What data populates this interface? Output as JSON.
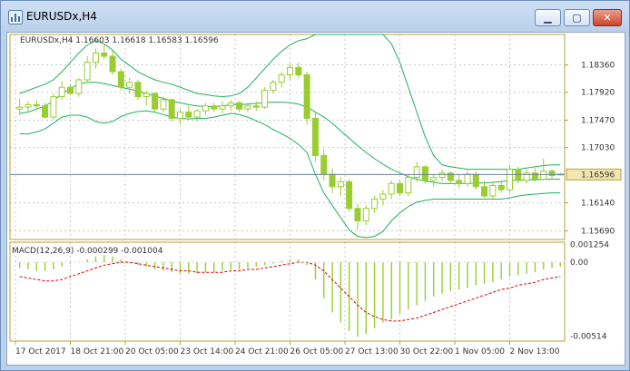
{
  "window": {
    "title": "EURUSDx,H4",
    "icon": "chart-window-icon",
    "buttons": {
      "minimize": "minimize-icon",
      "maximize": "maximize-icon",
      "close": "close-icon"
    }
  },
  "main_legend": "EURUSDx,H4  1.16603 1.16618 1.16583 1.16596",
  "macd_legend": "MACD(12,26,9) -0.000299 -0.001004",
  "price_axis": [
    "1.18360",
    "1.17920",
    "1.17470",
    "1.17030",
    "1.16140",
    "1.15690"
  ],
  "current_price": "1.16596",
  "macd_axis": [
    "0.001254",
    "0.00",
    "-0.00514"
  ],
  "time_axis": [
    "17 Oct 2017",
    "18 Oct 21:00",
    "20 Oct 05:00",
    "23 Oct 14:00",
    "24 Oct 21:00",
    "26 Oct 05:00",
    "27 Oct 13:00",
    "30 Oct 22:00",
    "1 Nov 05:00",
    "2 Nov 13:00"
  ],
  "colors": {
    "candle": "#9acd32",
    "bollinger": "#20b060",
    "grid": "#c8c8c8",
    "price_line": "#6a7fa8",
    "macd_signal": "#e00000",
    "macd_hist": "#9acd32",
    "badge_fill": "#f3e7b0",
    "axis_border": "#b8a23a"
  },
  "chart_data": {
    "type": "candlestick",
    "symbol": "EURUSDx",
    "timeframe": "H4",
    "last_bar": {
      "open": 1.16603,
      "high": 1.16618,
      "low": 1.16583,
      "close": 1.16596
    },
    "ylim": [
      1.1555,
      1.1885
    ],
    "grid": true,
    "ohlc": [
      [
        1.1765,
        1.1782,
        1.1755,
        1.1768
      ],
      [
        1.1768,
        1.1778,
        1.176,
        1.1772
      ],
      [
        1.1772,
        1.178,
        1.1765,
        1.177
      ],
      [
        1.177,
        1.1775,
        1.175,
        1.1752
      ],
      [
        1.1752,
        1.179,
        1.1748,
        1.1785
      ],
      [
        1.1785,
        1.181,
        1.178,
        1.18
      ],
      [
        1.18,
        1.1805,
        1.1788,
        1.179
      ],
      [
        1.179,
        1.1815,
        1.1785,
        1.1812
      ],
      [
        1.1812,
        1.185,
        1.1808,
        1.184
      ],
      [
        1.184,
        1.1862,
        1.183,
        1.1855
      ],
      [
        1.1855,
        1.187,
        1.1845,
        1.185
      ],
      [
        1.185,
        1.186,
        1.182,
        1.1825
      ],
      [
        1.1825,
        1.183,
        1.1795,
        1.18
      ],
      [
        1.18,
        1.1815,
        1.179,
        1.1808
      ],
      [
        1.1808,
        1.1812,
        1.178,
        1.1785
      ],
      [
        1.1785,
        1.1795,
        1.177,
        1.179
      ],
      [
        1.179,
        1.1792,
        1.176,
        1.1765
      ],
      [
        1.1765,
        1.1785,
        1.176,
        1.178
      ],
      [
        1.178,
        1.1782,
        1.1745,
        1.175
      ],
      [
        1.175,
        1.1765,
        1.174,
        1.176
      ],
      [
        1.176,
        1.177,
        1.1748,
        1.1752
      ],
      [
        1.1752,
        1.1765,
        1.1745,
        1.1762
      ],
      [
        1.1762,
        1.1775,
        1.1755,
        1.177
      ],
      [
        1.177,
        1.1775,
        1.176,
        1.1765
      ],
      [
        1.1765,
        1.1778,
        1.1758,
        1.177
      ],
      [
        1.177,
        1.178,
        1.1762,
        1.1775
      ],
      [
        1.1775,
        1.1778,
        1.176,
        1.1765
      ],
      [
        1.1765,
        1.1775,
        1.176,
        1.177
      ],
      [
        1.177,
        1.1778,
        1.1762,
        1.1768
      ],
      [
        1.1768,
        1.18,
        1.1765,
        1.1795
      ],
      [
        1.1795,
        1.1812,
        1.179,
        1.1808
      ],
      [
        1.1808,
        1.1825,
        1.18,
        1.182
      ],
      [
        1.182,
        1.1838,
        1.1812,
        1.1832
      ],
      [
        1.1832,
        1.184,
        1.1815,
        1.182
      ],
      [
        1.182,
        1.1825,
        1.174,
        1.175
      ],
      [
        1.175,
        1.176,
        1.168,
        1.169
      ],
      [
        1.169,
        1.17,
        1.165,
        1.166
      ],
      [
        1.166,
        1.167,
        1.163,
        1.164
      ],
      [
        1.164,
        1.1655,
        1.1625,
        1.1648
      ],
      [
        1.1648,
        1.1652,
        1.16,
        1.1605
      ],
      [
        1.1605,
        1.1612,
        1.157,
        1.1585
      ],
      [
        1.1585,
        1.161,
        1.1578,
        1.1605
      ],
      [
        1.1605,
        1.1625,
        1.1598,
        1.162
      ],
      [
        1.162,
        1.1635,
        1.161,
        1.1628
      ],
      [
        1.1628,
        1.165,
        1.162,
        1.1645
      ],
      [
        1.1645,
        1.1652,
        1.1625,
        1.163
      ],
      [
        1.163,
        1.166,
        1.1625,
        1.1655
      ],
      [
        1.1655,
        1.168,
        1.1648,
        1.1672
      ],
      [
        1.1672,
        1.1675,
        1.1645,
        1.165
      ],
      [
        1.165,
        1.166,
        1.164,
        1.1655
      ],
      [
        1.1655,
        1.1668,
        1.1648,
        1.1662
      ],
      [
        1.1662,
        1.1665,
        1.1645,
        1.165
      ],
      [
        1.165,
        1.166,
        1.1638,
        1.1645
      ],
      [
        1.1645,
        1.1665,
        1.164,
        1.166
      ],
      [
        1.166,
        1.1665,
        1.1635,
        1.164
      ],
      [
        1.164,
        1.165,
        1.1622,
        1.1625
      ],
      [
        1.1625,
        1.1648,
        1.162,
        1.1642
      ],
      [
        1.1642,
        1.165,
        1.163,
        1.1635
      ],
      [
        1.1635,
        1.1675,
        1.163,
        1.1668
      ],
      [
        1.1668,
        1.1672,
        1.1645,
        1.165
      ],
      [
        1.165,
        1.1668,
        1.1645,
        1.1662
      ],
      [
        1.1662,
        1.167,
        1.1648,
        1.1652
      ],
      [
        1.1652,
        1.1685,
        1.165,
        1.1665
      ],
      [
        1.1665,
        1.1668,
        1.1652,
        1.1658
      ],
      [
        1.16603,
        1.16618,
        1.16583,
        1.16596
      ]
    ],
    "bollinger": {
      "upper": [
        1.179,
        1.1795,
        1.18,
        1.1805,
        1.1812,
        1.1825,
        1.184,
        1.1855,
        1.1868,
        1.1875,
        1.187,
        1.186,
        1.1845,
        1.1835,
        1.1825,
        1.1818,
        1.1812,
        1.1808,
        1.1805,
        1.18,
        1.1795,
        1.179,
        1.1788,
        1.1786,
        1.1785,
        1.1786,
        1.179,
        1.18,
        1.1815,
        1.183,
        1.1845,
        1.1858,
        1.1868,
        1.1875,
        1.1878,
        1.1885,
        1.1885,
        1.1885,
        1.1885,
        1.1885,
        1.1885,
        1.1885,
        1.1885,
        1.1885,
        1.187,
        1.184,
        1.18,
        1.176,
        1.172,
        1.169,
        1.1675,
        1.1672,
        1.167,
        1.1668,
        1.1668,
        1.1668,
        1.1668,
        1.1668,
        1.1668,
        1.1668,
        1.167,
        1.1672,
        1.1674,
        1.1675,
        1.1675
      ],
      "middle": [
        1.1758,
        1.176,
        1.1765,
        1.177,
        1.1778,
        1.179,
        1.1798,
        1.1805,
        1.1808,
        1.1808,
        1.1806,
        1.1803,
        1.18,
        1.1797,
        1.1794,
        1.179,
        1.1786,
        1.1782,
        1.1778,
        1.1775,
        1.1772,
        1.177,
        1.1769,
        1.1769,
        1.177,
        1.1772,
        1.1772,
        1.1773,
        1.1774,
        1.1775,
        1.1776,
        1.1776,
        1.1775,
        1.1773,
        1.1768,
        1.176,
        1.1752,
        1.1742,
        1.173,
        1.1718,
        1.1706,
        1.1695,
        1.1685,
        1.1676,
        1.1668,
        1.1662,
        1.1656,
        1.1652,
        1.1649,
        1.1647,
        1.1645,
        1.1645,
        1.1645,
        1.1645,
        1.1646,
        1.1646,
        1.1647,
        1.1648,
        1.165,
        1.165,
        1.1651,
        1.1651,
        1.1652,
        1.1652,
        1.1652
      ],
      "lower": [
        1.1725,
        1.1725,
        1.1728,
        1.1733,
        1.1742,
        1.1752,
        1.1755,
        1.1755,
        1.1752,
        1.1745,
        1.1742,
        1.1745,
        1.1753,
        1.1758,
        1.1761,
        1.1762,
        1.176,
        1.1756,
        1.1752,
        1.175,
        1.1749,
        1.175,
        1.175,
        1.1752,
        1.1755,
        1.1758,
        1.1756,
        1.1752,
        1.1746,
        1.174,
        1.1732,
        1.1725,
        1.1718,
        1.1708,
        1.1695,
        1.166,
        1.163,
        1.161,
        1.159,
        1.157,
        1.156,
        1.1558,
        1.156,
        1.1568,
        1.1585,
        1.1598,
        1.1608,
        1.1615,
        1.1618,
        1.162,
        1.162,
        1.162,
        1.162,
        1.162,
        1.162,
        1.162,
        1.162,
        1.162,
        1.1622,
        1.1625,
        1.1627,
        1.1628,
        1.1629,
        1.163,
        1.163
      ]
    },
    "macd": {
      "ylim": [
        -0.0055,
        0.0014
      ],
      "histogram": [
        -0.0004,
        -0.0005,
        -0.0006,
        -0.0006,
        -0.0005,
        -0.0003,
        -0.0001,
        0.0,
        0.0002,
        0.0004,
        0.0005,
        0.0004,
        0.0002,
        0.0,
        -0.0002,
        -0.0003,
        -0.0005,
        -0.0006,
        -0.0007,
        -0.0008,
        -0.0008,
        -0.0008,
        -0.0007,
        -0.0007,
        -0.0006,
        -0.0005,
        -0.0005,
        -0.0004,
        -0.0003,
        -0.0002,
        -0.0001,
        0.0001,
        0.0002,
        0.0002,
        -0.0002,
        -0.0012,
        -0.0025,
        -0.0035,
        -0.0042,
        -0.0048,
        -0.0052,
        -0.005,
        -0.0046,
        -0.0042,
        -0.004,
        -0.0036,
        -0.0033,
        -0.003,
        -0.0027,
        -0.0024,
        -0.0022,
        -0.002,
        -0.0019,
        -0.0018,
        -0.0016,
        -0.0015,
        -0.0014,
        -0.0012,
        -0.001,
        -0.0009,
        -0.0008,
        -0.0007,
        -0.0005,
        -0.0004,
        -0.000299
      ],
      "signal": [
        -0.001,
        -0.0011,
        -0.0012,
        -0.0013,
        -0.0013,
        -0.0012,
        -0.001,
        -0.0008,
        -0.0006,
        -0.0004,
        -0.0002,
        -0.0001,
        0.0,
        0.0,
        -0.0001,
        -0.0002,
        -0.0003,
        -0.0004,
        -0.0005,
        -0.0006,
        -0.0006,
        -0.0007,
        -0.0007,
        -0.0007,
        -0.0007,
        -0.0006,
        -0.0006,
        -0.0005,
        -0.0005,
        -0.0004,
        -0.0003,
        -0.0002,
        -0.0001,
        0.0,
        0.0,
        -0.0002,
        -0.0006,
        -0.0012,
        -0.0018,
        -0.0024,
        -0.003,
        -0.0035,
        -0.0038,
        -0.004,
        -0.0041,
        -0.0041,
        -0.004,
        -0.0039,
        -0.0037,
        -0.0035,
        -0.0033,
        -0.0031,
        -0.0029,
        -0.0027,
        -0.0025,
        -0.0023,
        -0.0021,
        -0.0019,
        -0.0018,
        -0.0016,
        -0.0015,
        -0.0014,
        -0.0012,
        -0.0011,
        -0.001004
      ]
    }
  }
}
